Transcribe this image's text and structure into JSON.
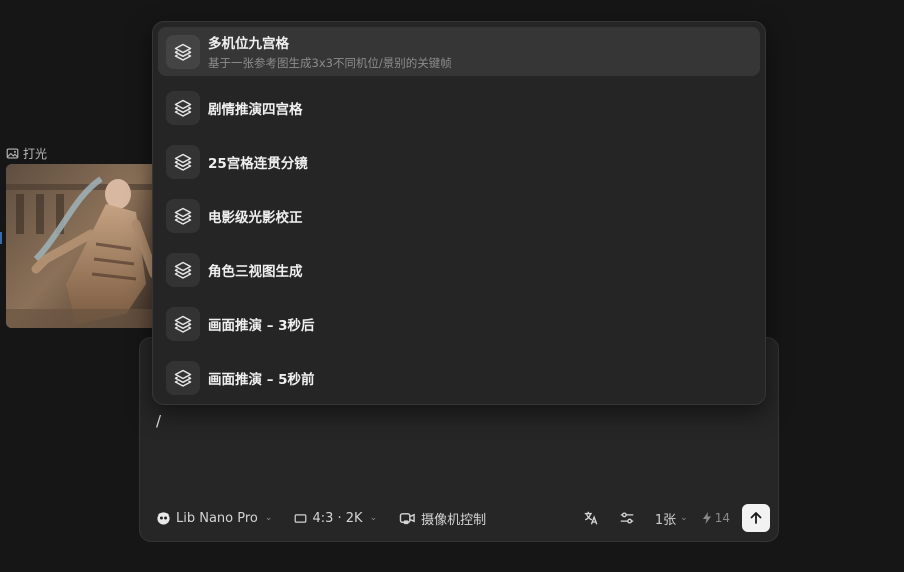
{
  "node": {
    "label": "打光",
    "label_icon": "image-icon"
  },
  "menu": {
    "items": [
      {
        "title": "多机位九宫格",
        "subtitle": "基于一张参考图生成3x3不同机位/景别的关键帧",
        "icon": "layers-icon",
        "active": true
      },
      {
        "title": "剧情推演四宫格",
        "icon": "layers-icon"
      },
      {
        "title": "25宫格连贯分镜",
        "icon": "layers-icon"
      },
      {
        "title": "电影级光影校正",
        "icon": "layers-icon"
      },
      {
        "title": "角色三视图生成",
        "icon": "layers-icon"
      },
      {
        "title": "画面推演 – 3秒后",
        "icon": "layers-icon"
      },
      {
        "title": "画面推演 – 5秒前",
        "icon": "layers-icon"
      }
    ]
  },
  "composer": {
    "prompt": "/",
    "model": "Lib Nano Pro",
    "ratio": "4:3 · 2K",
    "camera": "摄像机控制",
    "count": "1张",
    "credits": "14"
  },
  "colors": {
    "background": "#161616",
    "panel": "#262626",
    "menu": "#252525",
    "active_item": "#363636",
    "send_button": "#f2f2f2"
  }
}
